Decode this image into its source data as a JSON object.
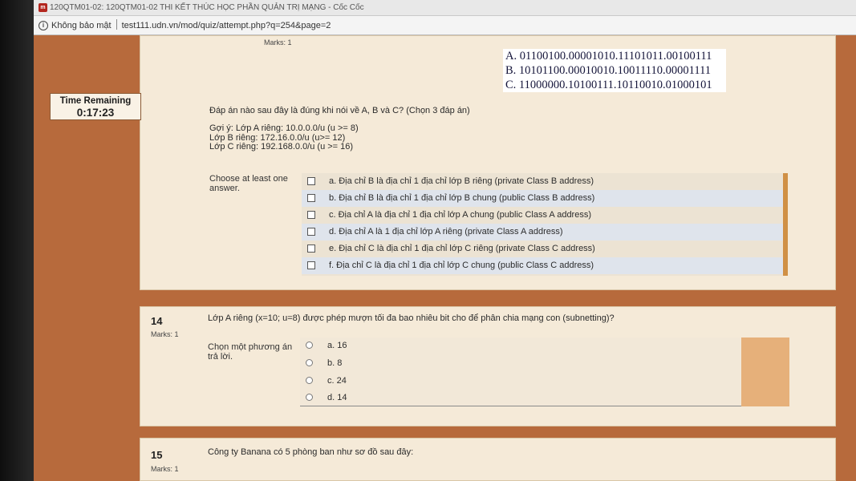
{
  "browser": {
    "tab_title": "120QTM01-02: 120QTM01-02 THI KẾT THÚC HỌC PHẦN QUẢN TRỊ MẠNG - Cốc Cốc",
    "favicon": "m",
    "security": "Không bảo mật",
    "url": "test111.udn.vn/mod/quiz/attempt.php?q=254&page=2"
  },
  "timer": {
    "label": "Time Remaining",
    "value": "0:17:23"
  },
  "q13": {
    "marks": "Marks: 1",
    "ip_lines": [
      "A. 01100100.00001010.11101011.00100111",
      "B. 10101100.00010010.10011110.00001111",
      "C. 11000000.10100111.10110010.01000101"
    ],
    "question": "Đáp án nào sau đây là đúng khi nói về A, B và C? (Chọn 3 đáp án)",
    "hint_lines": [
      "Gợi ý: Lớp A riêng: 10.0.0.0/u (u >= 8)",
      "Lớp B riêng: 172.16.0.0/u (u>= 12)",
      "Lớp C riêng: 192.168.0.0/u (u >= 16)"
    ],
    "choose_label": "Choose at least one answer.",
    "answers": [
      "a. Địa chỉ B là địa chỉ 1 địa chỉ lớp B riêng (private Class B address)",
      "b. Địa chỉ B là địa chỉ 1 địa chỉ lớp B chung (public Class B address)",
      "c. Địa chỉ A là địa chỉ 1 địa chỉ lớp A chung (public Class A address)",
      "d. Địa chỉ A là 1 địa chỉ lớp A riêng (private Class A address)",
      "e. Địa chỉ C là địa chỉ 1 địa chỉ lớp C riêng (private Class C address)",
      "f. Địa chỉ C là địa chỉ 1 địa chỉ lớp C chung (public Class C address)"
    ]
  },
  "q14": {
    "number": "14",
    "marks": "Marks: 1",
    "question": "Lớp A riêng (x=10; u=8) được phép mượn tối đa bao nhiêu bit cho để phân chia mạng con (subnetting)?",
    "choose_label": "Chọn một phương án trả lời.",
    "answers": [
      "a. 16",
      "b. 8",
      "c. 24",
      "d. 14"
    ]
  },
  "q15": {
    "number": "15",
    "marks": "Marks: 1",
    "question": "Công ty Banana có 5 phòng ban như sơ đồ sau đây:"
  },
  "colors": {
    "page_background": "#b76a3c",
    "panel": "#f5ead8",
    "answer_highlight": "#dfe4ec",
    "accent_bar": "#d09045"
  }
}
